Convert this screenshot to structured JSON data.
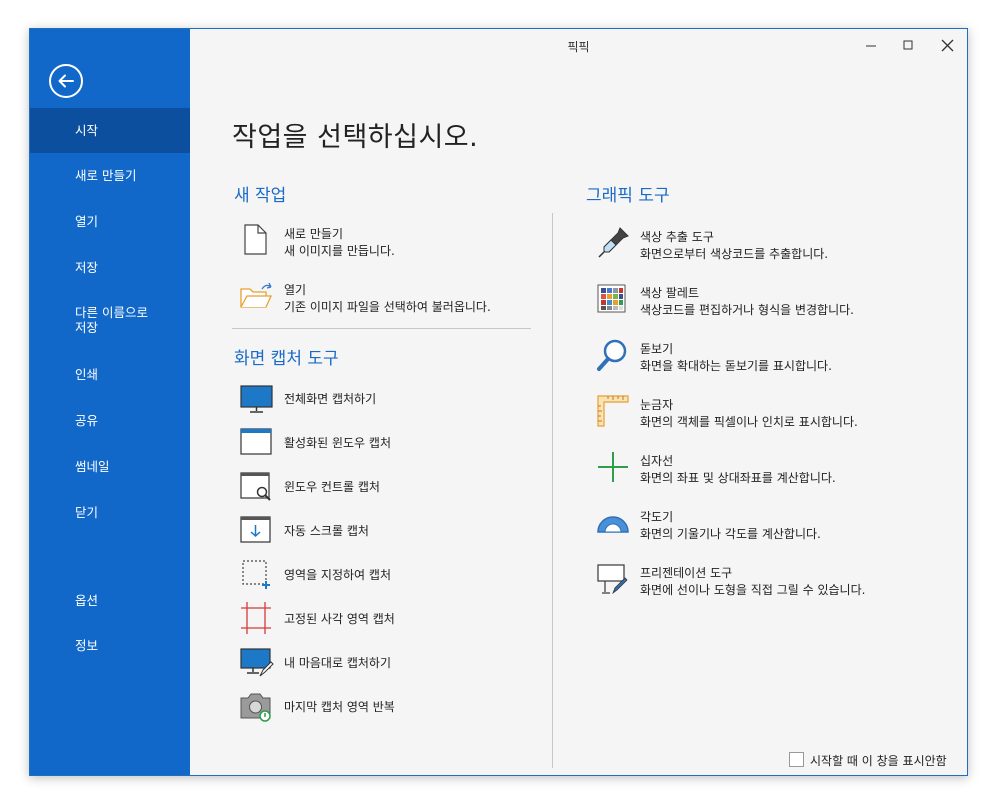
{
  "window": {
    "title": "픽픽"
  },
  "sidebar": {
    "items": [
      {
        "label": "시작",
        "active": true
      },
      {
        "label": "새로 만들기"
      },
      {
        "label": "열기"
      },
      {
        "label": "저장"
      },
      {
        "label": "다른 이름으로\n저장"
      },
      {
        "label": "인쇄"
      },
      {
        "label": "공유"
      },
      {
        "label": "썸네일"
      },
      {
        "label": "닫기"
      },
      {
        "label": "옵션"
      },
      {
        "label": "정보"
      }
    ]
  },
  "main": {
    "title": "작업을 선택하십시오.",
    "new_task": {
      "heading": "새 작업",
      "items": [
        {
          "title": "새로 만들기",
          "desc": "새 이미지를 만듭니다.",
          "icon": "new-file-icon"
        },
        {
          "title": "열기",
          "desc": "기존 이미지 파일을 선택하여 불러옵니다.",
          "icon": "open-folder-icon"
        }
      ]
    },
    "capture": {
      "heading": "화면 캡처 도구",
      "items": [
        {
          "title": "전체화면 캡처하기",
          "icon": "monitor-icon"
        },
        {
          "title": "활성화된 윈도우 캡처",
          "icon": "active-window-icon"
        },
        {
          "title": "윈도우 컨트롤 캡처",
          "icon": "window-control-icon"
        },
        {
          "title": "자동 스크롤 캡처",
          "icon": "scroll-capture-icon"
        },
        {
          "title": "영역을 지정하여 캡처",
          "icon": "region-select-icon"
        },
        {
          "title": "고정된 사각 영역 캡처",
          "icon": "fixed-rect-icon"
        },
        {
          "title": "내 마음대로 캡처하기",
          "icon": "freehand-icon"
        },
        {
          "title": "마지막 캡처 영역 반복",
          "icon": "repeat-camera-icon"
        }
      ]
    },
    "graphic": {
      "heading": "그래픽 도구",
      "items": [
        {
          "title": "색상 추출 도구",
          "desc": "화면으로부터 색상코드를 추출합니다.",
          "icon": "eyedropper-icon"
        },
        {
          "title": "색상 팔레트",
          "desc": "색상코드를 편집하거나 형식을 변경합니다.",
          "icon": "palette-icon"
        },
        {
          "title": "돋보기",
          "desc": "화면을 확대하는 돋보기를 표시합니다.",
          "icon": "magnifier-icon"
        },
        {
          "title": "눈금자",
          "desc": "화면의 객체를 픽셀이나 인치로 표시합니다.",
          "icon": "ruler-icon"
        },
        {
          "title": "십자선",
          "desc": "화면의 좌표 및 상대좌표를 계산합니다.",
          "icon": "crosshair-icon"
        },
        {
          "title": "각도기",
          "desc": "화면의 기울기나 각도를 계산합니다.",
          "icon": "protractor-icon"
        },
        {
          "title": "프리젠테이션 도구",
          "desc": "화면에 선이나 도형을 직접 그릴 수 있습니다.",
          "icon": "whiteboard-pen-icon"
        }
      ]
    },
    "startup_checkbox": {
      "label": "시작할 때 이 창을 표시안함",
      "checked": false
    }
  },
  "colors": {
    "sidebar": "#1268c9",
    "sidebar_active": "#0b4f9e",
    "accent": "#1a6bc8"
  }
}
